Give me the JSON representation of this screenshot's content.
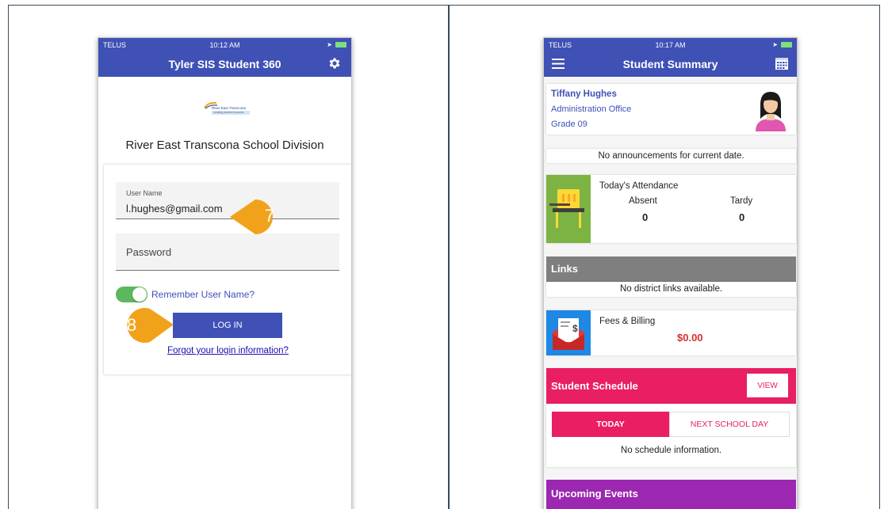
{
  "left_phone": {
    "status": {
      "carrier": "TELUS",
      "time": "10:12 AM"
    },
    "appbar_title": "Tyler SIS Student 360",
    "logo": {
      "name": "River East Transcona",
      "tagline": "creating student success"
    },
    "school_title": "River East Transcona School Division",
    "form": {
      "username_label": "User Name",
      "username_value": "l.hughes@gmail.com",
      "password_placeholder": "Password",
      "remember_label": "Remember User Name?",
      "remember_on": true,
      "login_label": "LOG IN",
      "forgot_label": "Forgot your login information?"
    },
    "markers": {
      "step7": "7",
      "step8": "8"
    }
  },
  "right_phone": {
    "status": {
      "carrier": "TELUS",
      "time": "10:17 AM"
    },
    "appbar_title": "Student Summary",
    "profile": {
      "name": "Tiffany Hughes",
      "office": "Administration Office",
      "grade": "Grade 09"
    },
    "announcements": "No announcements for current date.",
    "attendance": {
      "title": "Today's Attendance",
      "absent_label": "Absent",
      "tardy_label": "Tardy",
      "absent_value": "0",
      "tardy_value": "0"
    },
    "links": {
      "header": "Links",
      "body": "No district links available."
    },
    "fees": {
      "title": "Fees & Billing",
      "amount": "$0.00"
    },
    "schedule": {
      "header": "Student Schedule",
      "view_label": "VIEW",
      "tab_today": "TODAY",
      "tab_next": "NEXT SCHOOL DAY",
      "empty": "No schedule information."
    },
    "events": {
      "header": "Upcoming Events"
    }
  },
  "colors": {
    "app_blue": "#3f51b5",
    "toggle_green": "#5cb85c",
    "marker_orange": "#f0a31a",
    "attendance_green": "#7cb342",
    "fees_blue": "#1e88e5",
    "schedule_pink": "#e91e63",
    "events_purple": "#9c27b0",
    "links_gray": "#7f7f7f",
    "fee_red": "#d32f2f"
  }
}
